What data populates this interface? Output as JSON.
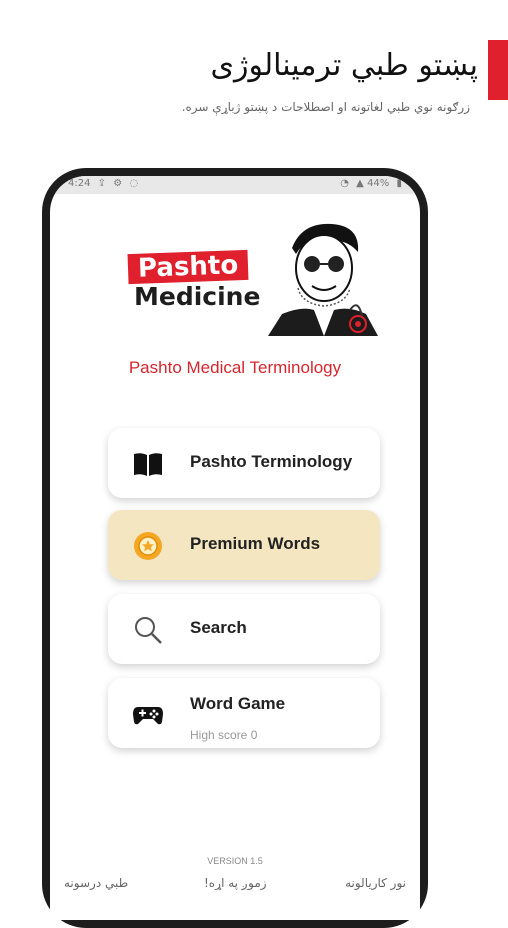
{
  "banner": {
    "headline": "پښتو طبي ترمينالوژی",
    "subline": "زرګونه نوي طبي لغاتونه او اصطلاحات د پښتو ژباړې سره.",
    "accent_color": "#e0202d"
  },
  "status_bar": {
    "time": "4:24",
    "left_icons": [
      "upload-icon",
      "settings-icon",
      "chat-icon"
    ],
    "battery": "44%",
    "right_icons": [
      "wifi-icon",
      "signal-icon",
      "battery-icon"
    ]
  },
  "logo": {
    "line1": "Pashto",
    "line2": "Medicine"
  },
  "app": {
    "title": "Pashto Medical Terminology",
    "title_color": "#d7262e"
  },
  "menu": {
    "items": [
      {
        "label": "Pashto Terminology",
        "icon": "book-icon"
      },
      {
        "label": "Premium Words",
        "icon": "premium-badge-icon"
      },
      {
        "label": "Search",
        "icon": "search-icon"
      },
      {
        "label": "Word Game",
        "icon": "gamepad-icon",
        "sub": "High score 0"
      }
    ]
  },
  "footer": {
    "version": "VERSION 1.5",
    "links": [
      "طبي درسونه",
      "زموږ په اړه!",
      "نور کاريالونه"
    ]
  }
}
